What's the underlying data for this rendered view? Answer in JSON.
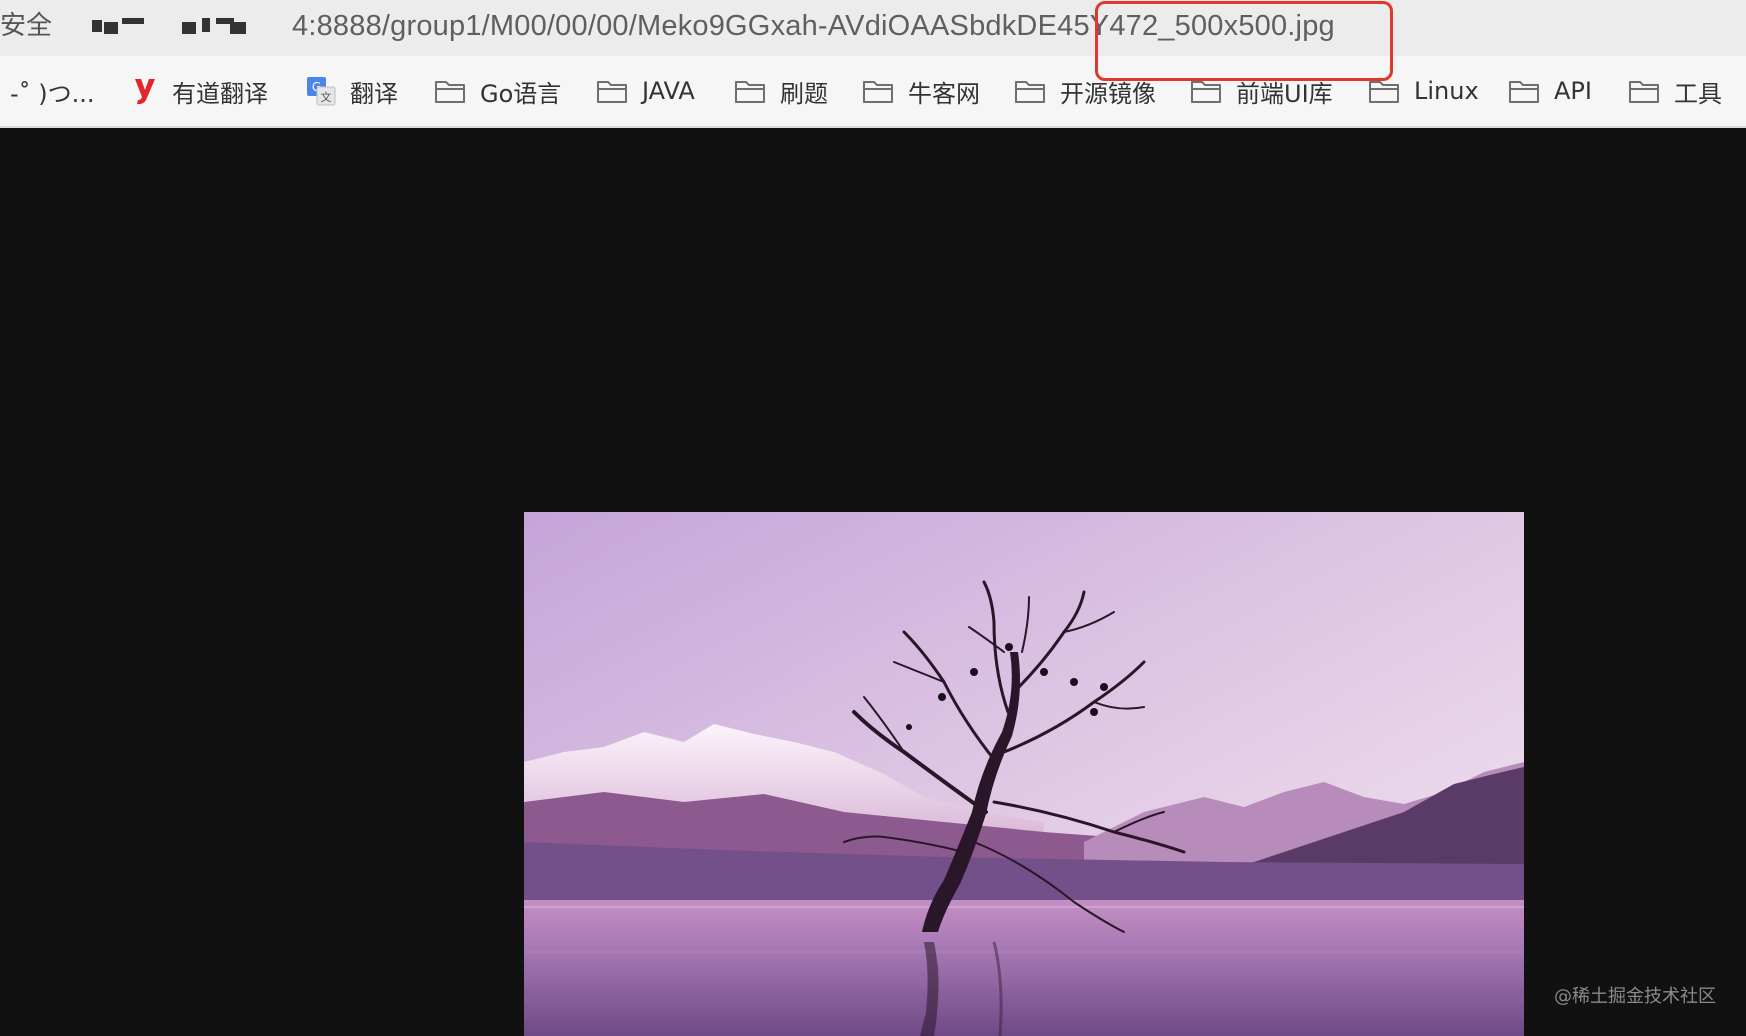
{
  "addressbar": {
    "security_label": "安全",
    "url": "4:8888/group1/M00/00/00/Meko9GGxah-AVdiOAASbdkDE45Y472_500x500.jpg"
  },
  "bookmarks": [
    {
      "label": "-˚ )つ...",
      "icon": "none"
    },
    {
      "label": "有道翻译",
      "icon": "youdao-logo"
    },
    {
      "label": "翻译",
      "icon": "google-translate-logo"
    },
    {
      "label": "Go语言",
      "icon": "folder-icon"
    },
    {
      "label": "JAVA",
      "icon": "folder-icon"
    },
    {
      "label": "刷题",
      "icon": "folder-icon"
    },
    {
      "label": "牛客网",
      "icon": "folder-icon"
    },
    {
      "label": "开源镜像",
      "icon": "folder-icon"
    },
    {
      "label": "前端UI库",
      "icon": "folder-icon"
    },
    {
      "label": "Linux",
      "icon": "folder-icon"
    },
    {
      "label": "API",
      "icon": "folder-icon"
    },
    {
      "label": "工具",
      "icon": "folder-icon"
    }
  ],
  "viewer": {
    "image_alt": "",
    "watermark": "@稀土掘金技术社区"
  },
  "colors": {
    "highlight_border": "#e0382b",
    "viewer_background": "#111111",
    "toolbar_background": "#f6f6f6"
  }
}
